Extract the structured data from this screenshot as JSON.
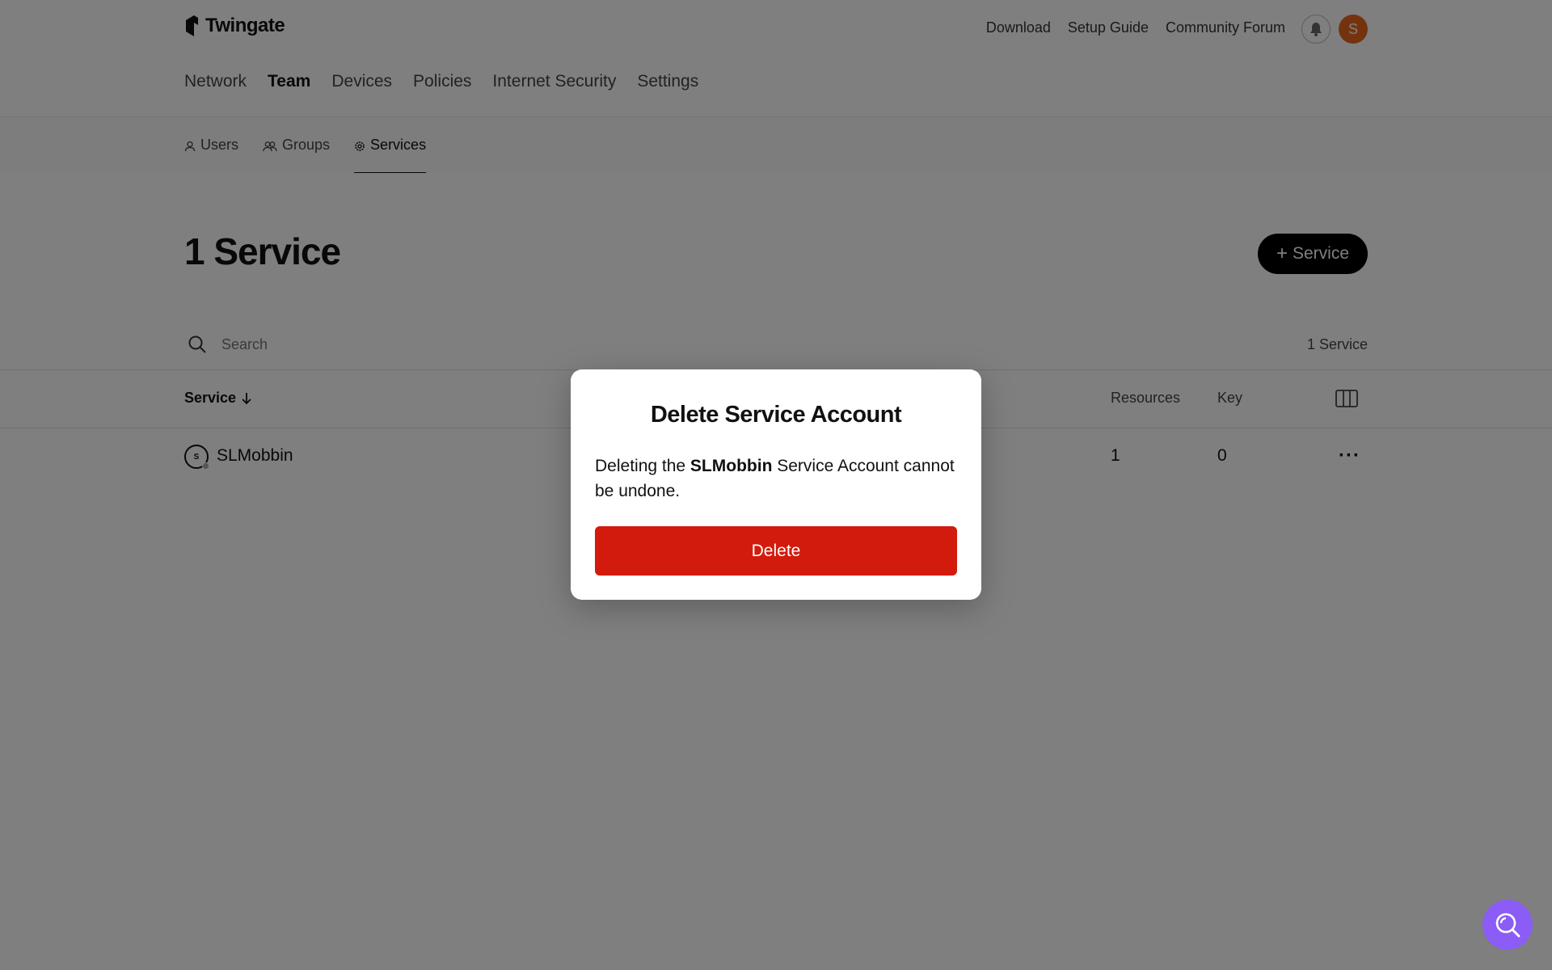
{
  "header": {
    "brand": "Twingate",
    "links": [
      "Download",
      "Setup Guide",
      "Community Forum"
    ],
    "avatar_initial": "S",
    "avatar_color": "#e8661f"
  },
  "main_nav": [
    "Network",
    "Team",
    "Devices",
    "Policies",
    "Internet Security",
    "Settings"
  ],
  "main_nav_active": "Team",
  "sub_nav": [
    {
      "label": "Users",
      "icon": "user-icon"
    },
    {
      "label": "Groups",
      "icon": "group-icon"
    },
    {
      "label": "Services",
      "icon": "gear-icon"
    }
  ],
  "sub_nav_active": "Services",
  "page": {
    "title": "1 Service",
    "add_button": "Service",
    "search_placeholder": "Search",
    "count": "1 Service"
  },
  "table": {
    "columns": [
      "Service",
      "Resources",
      "Key"
    ],
    "rows": [
      {
        "avatar": "S",
        "name": "SLMobbin",
        "resources": "1",
        "key": "0"
      }
    ]
  },
  "modal": {
    "title": "Delete Service Account",
    "body_prefix": "Deleting the ",
    "body_name": "SLMobbin",
    "body_suffix": " Service Account cannot be undone.",
    "button": "Delete",
    "button_color": "#d21b0c"
  },
  "help_color": "#8b5cf6"
}
